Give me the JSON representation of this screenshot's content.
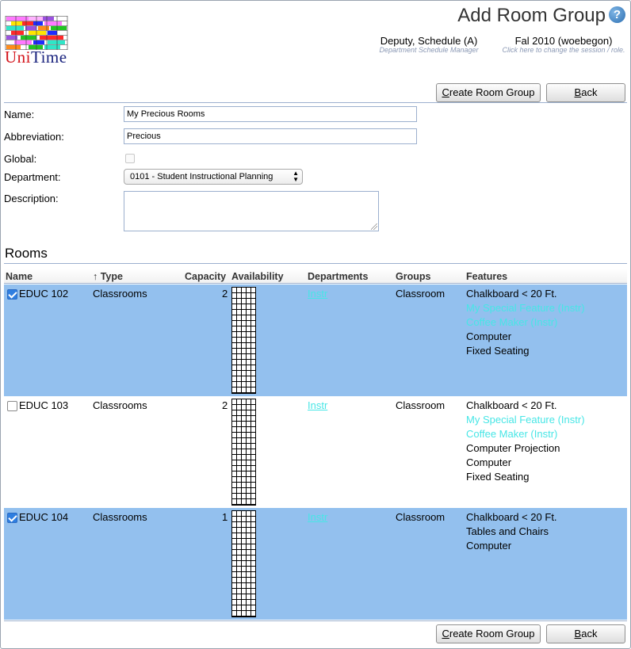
{
  "app": {
    "logo_text_1": "Uni",
    "logo_text_2": "Time",
    "logo_colors": [
      "#ff7aff",
      "#9b51e0",
      "#2ee6c8",
      "#ffe600",
      "#ff2a2a",
      "#1f2bff",
      "#23c423",
      "#ff8c1a"
    ]
  },
  "header": {
    "title": "Add Room Group",
    "help_icon": "question-icon"
  },
  "user": {
    "name": "Deputy, Schedule (A)",
    "role": "Department Schedule Manager",
    "session": "Fal 2010 (woebegon)",
    "session_hint": "Click here to change the session / role."
  },
  "actions": {
    "create": "Create Room Group",
    "create_underlined": "C",
    "create_rest": "reate Room Group",
    "back": "Back",
    "back_underlined": "B",
    "back_rest": "ack"
  },
  "form": {
    "name_label": "Name:",
    "name_value": "My Precious Rooms",
    "abbr_label": "Abbreviation:",
    "abbr_value": "Precious",
    "global_label": "Global:",
    "global_checked": false,
    "department_label": "Department:",
    "department_value": "0101 - Student Instructional Planning",
    "description_label": "Description:",
    "description_value": ""
  },
  "rooms": {
    "title": "Rooms",
    "columns": {
      "name": "Name",
      "type": "↑ Type",
      "capacity": "Capacity",
      "availability": "Availability",
      "departments": "Departments",
      "groups": "Groups",
      "features": "Features"
    },
    "rows": [
      {
        "selected": true,
        "name": "EDUC 102",
        "type": "Classrooms",
        "capacity": "2",
        "department": "Instr",
        "group": "Classroom",
        "features": [
          {
            "text": "Chalkboard < 20 Ft.",
            "highlight": false
          },
          {
            "text": "My Special Feature (Instr)",
            "highlight": true
          },
          {
            "text": "Coffee Maker (Instr)",
            "highlight": true
          },
          {
            "text": "Computer",
            "highlight": false
          },
          {
            "text": "Fixed Seating",
            "highlight": false
          }
        ]
      },
      {
        "selected": false,
        "name": "EDUC 103",
        "type": "Classrooms",
        "capacity": "2",
        "department": "Instr",
        "group": "Classroom",
        "features": [
          {
            "text": "Chalkboard < 20 Ft.",
            "highlight": false
          },
          {
            "text": "My Special Feature (Instr)",
            "highlight": true
          },
          {
            "text": "Coffee Maker (Instr)",
            "highlight": true
          },
          {
            "text": "Computer Projection",
            "highlight": false
          },
          {
            "text": "Computer",
            "highlight": false
          },
          {
            "text": "Fixed Seating",
            "highlight": false
          }
        ]
      },
      {
        "selected": true,
        "name": "EDUC 104",
        "type": "Classrooms",
        "capacity": "1",
        "department": "Instr",
        "group": "Classroom",
        "features": [
          {
            "text": "Chalkboard < 20 Ft.",
            "highlight": false
          },
          {
            "text": "Tables and Chairs",
            "highlight": false
          },
          {
            "text": "Computer",
            "highlight": false
          }
        ]
      }
    ]
  }
}
